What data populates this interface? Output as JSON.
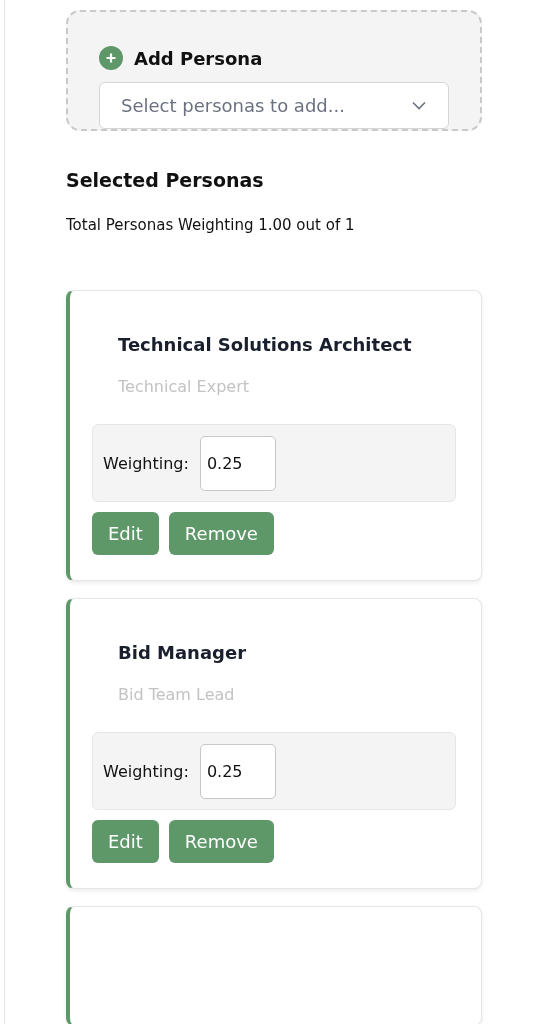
{
  "add_persona": {
    "title": "Add Persona",
    "placeholder": "Select personas to add..."
  },
  "selected_heading": "Selected Personas",
  "total_weighting": "Total Personas Weighting 1.00 out of 1",
  "personas": [
    {
      "kind": "full",
      "name": "Technical Solutions Architect",
      "role": "Technical Expert",
      "weighting_label": "Weighting:",
      "weighting": "0.25",
      "buttons": [
        "Edit",
        "Remove"
      ]
    },
    {
      "kind": "full",
      "name": "Bid Manager",
      "role": "Bid Team Lead",
      "weighting_label": "Weighting:",
      "weighting": "0.25",
      "buttons": [
        "Edit",
        "Remove"
      ]
    },
    {
      "kind": "partial"
    }
  ]
}
